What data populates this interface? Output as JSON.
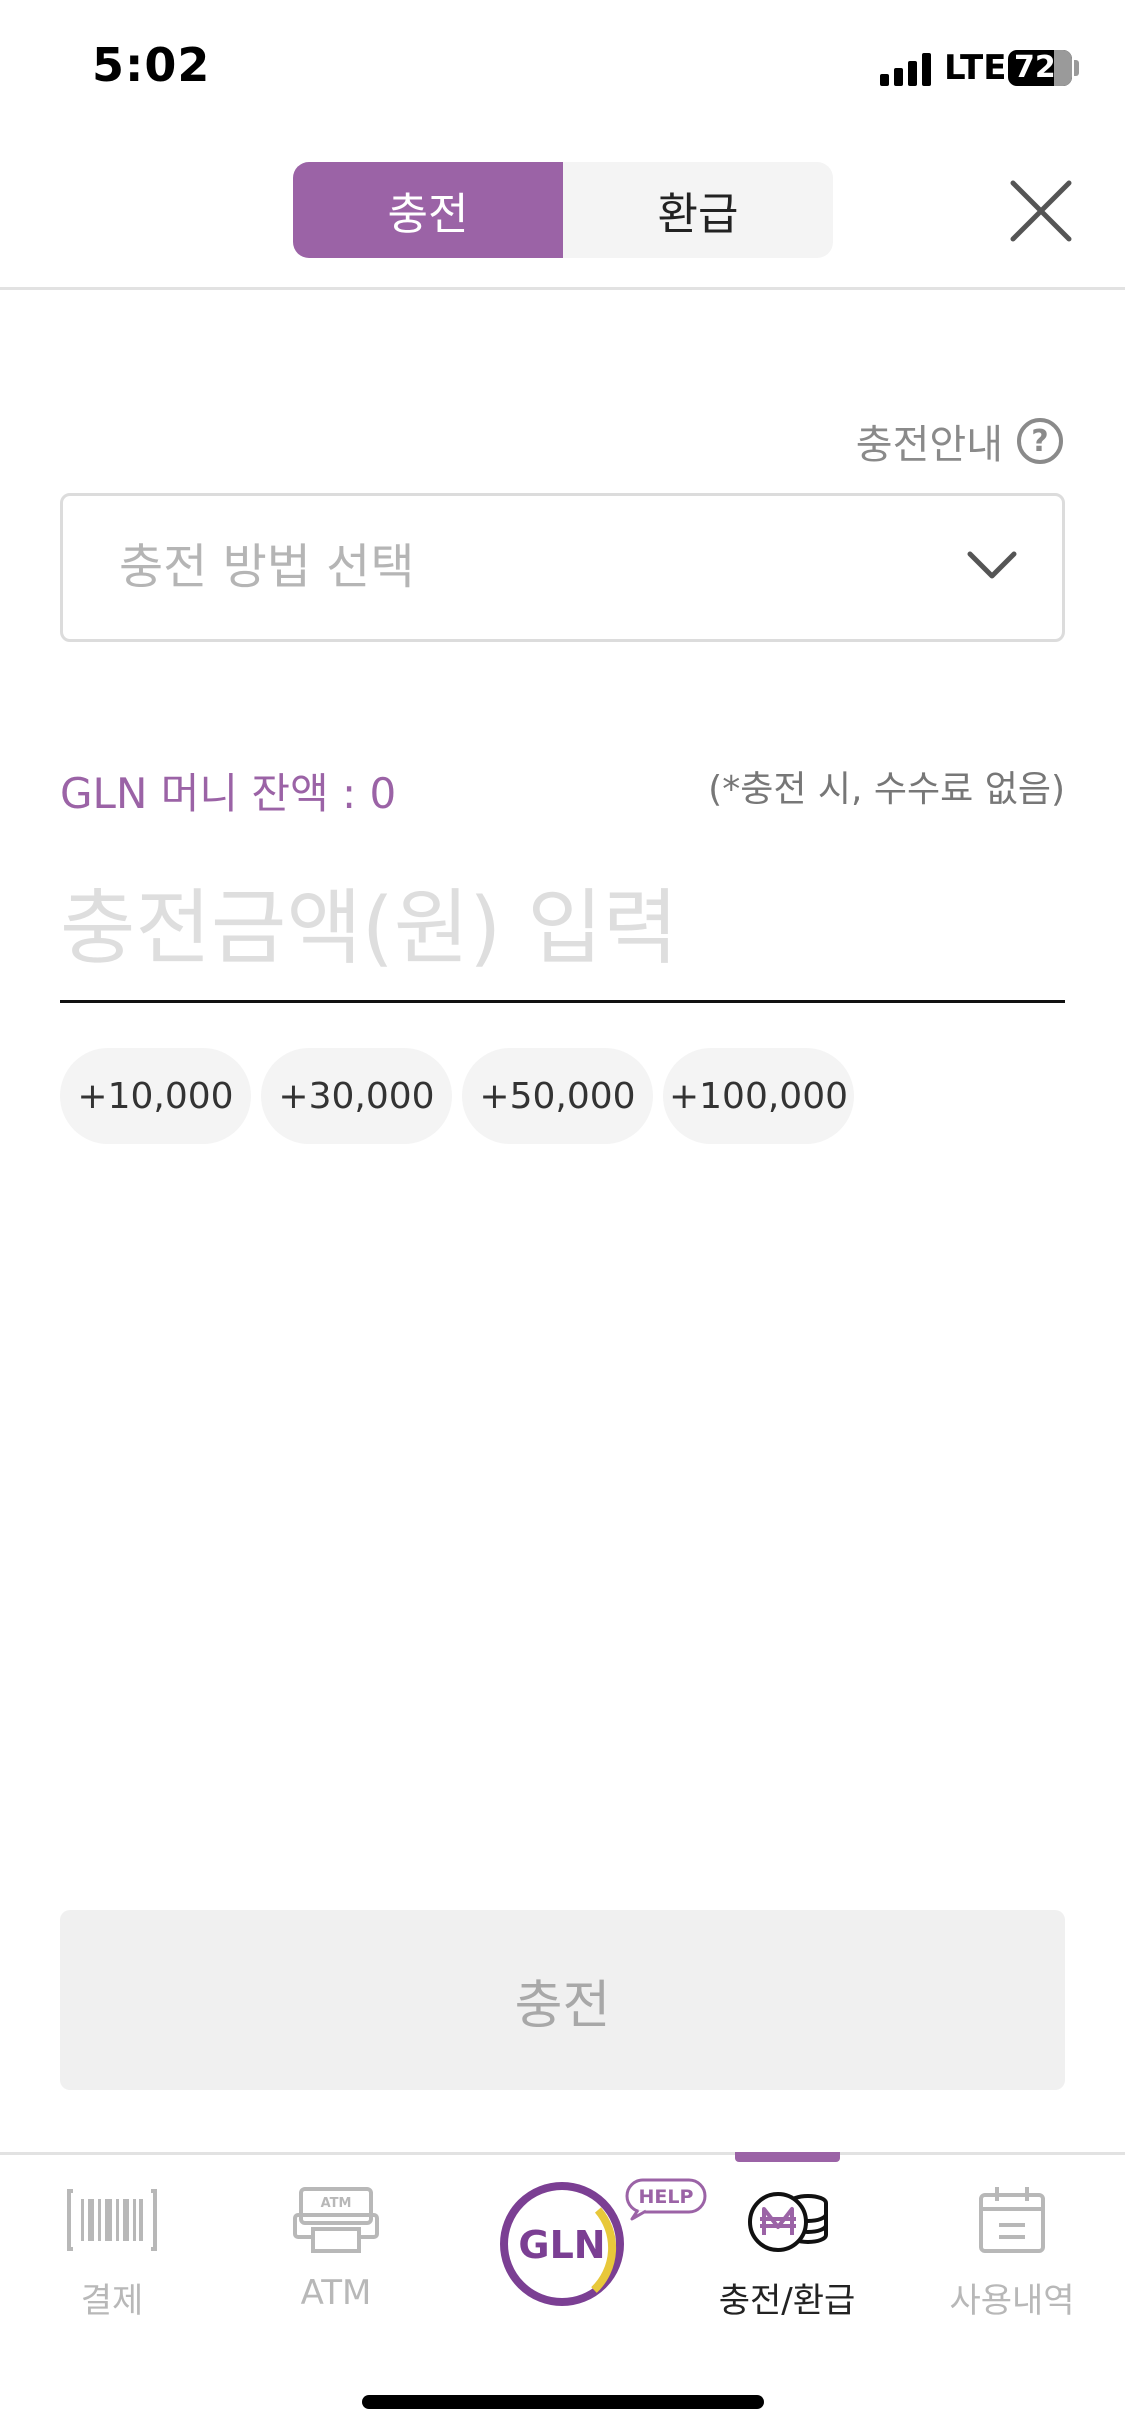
{
  "status_bar": {
    "time": "5:02",
    "network": "LTE",
    "battery": "72"
  },
  "header": {
    "tabs": [
      {
        "label": "충전",
        "active": true
      },
      {
        "label": "환급",
        "active": false
      }
    ],
    "close_icon": "close-icon"
  },
  "charge": {
    "guide_label": "충전안내",
    "guide_icon_text": "?",
    "method_placeholder": "충전 방법 선택",
    "balance_label": "GLN 머니 잔액 : 0",
    "fee_note": "(*충전 시, 수수료 없음)",
    "amount_placeholder": "충전금액(원) 입력",
    "amount_value": "",
    "quick_amounts": [
      "+10,000",
      "+30,000",
      "+50,000",
      "+100,000"
    ],
    "submit_label": "충전"
  },
  "bottom_nav": {
    "items": [
      {
        "label": "결제",
        "icon": "barcode-icon"
      },
      {
        "label": "ATM",
        "icon": "atm-icon",
        "icon_text": "ATM"
      },
      {
        "label": "",
        "icon": "gln-logo-icon",
        "logo_text": "GLN",
        "badge": "HELP"
      },
      {
        "label": "충전/환급",
        "icon": "coin-stack-icon",
        "active": true
      },
      {
        "label": "사용내역",
        "icon": "calendar-icon"
      }
    ]
  },
  "colors": {
    "accent": "#9b63a6",
    "muted": "#b8b8b8"
  }
}
